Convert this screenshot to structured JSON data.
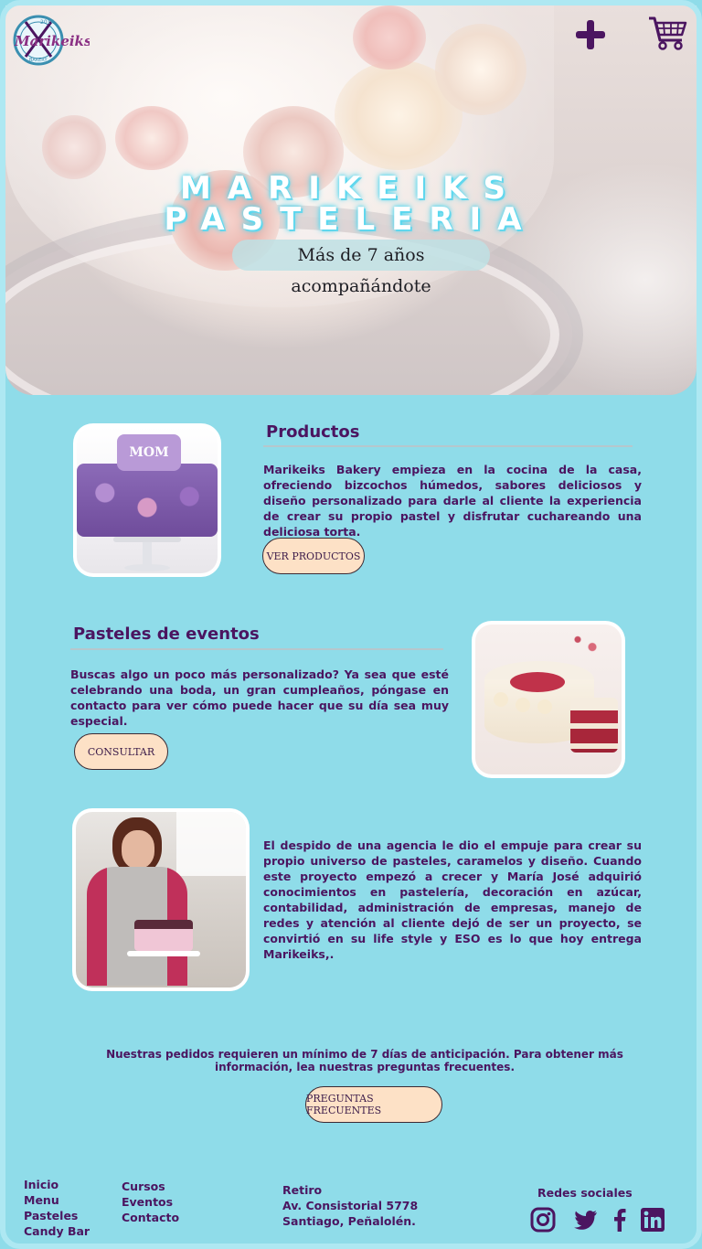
{
  "hero": {
    "title_line1": "MARIKEIKS",
    "title_line2": "PASTELERIA",
    "subtitle": "Más de 7 años acompañándote",
    "logo_text": "Marikeiks",
    "logo_year": "2014",
    "logo_label": "BAKERY",
    "plus_icon": "plus-icon",
    "cart_icon": "shopping-cart-icon"
  },
  "productos": {
    "title": "Productos",
    "text": "Marikeiks Bakery empieza en la cocina de la casa, ofreciendo bizcochos húmedos, sabores deliciosos y diseño personalizado para darle al cliente la experiencia de crear su propio pastel y disfrutar cuchareando una deliciosa torta.",
    "button": "VER PRODUCTOS",
    "image_label": "MOM"
  },
  "eventos": {
    "title": "Pasteles de eventos",
    "text": "Buscas algo un poco más personalizado? Ya sea que esté celebrando una boda, un gran cumpleaños, póngase en contacto para ver cómo puede hacer que su día sea muy especial.",
    "button": "CONSULTAR"
  },
  "historia": {
    "text": "El despido de una agencia le dio el empuje para crear su propio universo de pasteles, caramelos y diseño. Cuando este proyecto empezó a crecer y María José adquirió conocimientos en pastelería, decoración en azúcar, contabilidad, administración de empresas, manejo de redes y atención al cliente dejó de ser un proyecto, se convirtió en su life style y ESO es lo que hoy entrega Marikeiks,."
  },
  "notice": {
    "text": "Nuestras pedidos requieren un mínimo de 7 días de anticipación. Para obtener más información, lea nuestras preguntas frecuentes.",
    "button": "PREGUNTAS FRECUENTES"
  },
  "footer": {
    "col1": [
      "Inicio",
      "Menu",
      "Pasteles",
      "Candy Bar"
    ],
    "col2": [
      "Cursos",
      "Eventos",
      "Contacto"
    ],
    "address": [
      "Retiro",
      "Av. Consistorial 5778",
      "Santiago, Peñalolén."
    ],
    "social_title": "Redes sociales",
    "social_icons": [
      "instagram-icon",
      "twitter-icon",
      "facebook-icon",
      "linkedin-icon"
    ]
  },
  "colors": {
    "background": "#8fdce9",
    "text": "#4b1560",
    "button": "#fde1c6",
    "title_glow": "#55d8f0"
  }
}
